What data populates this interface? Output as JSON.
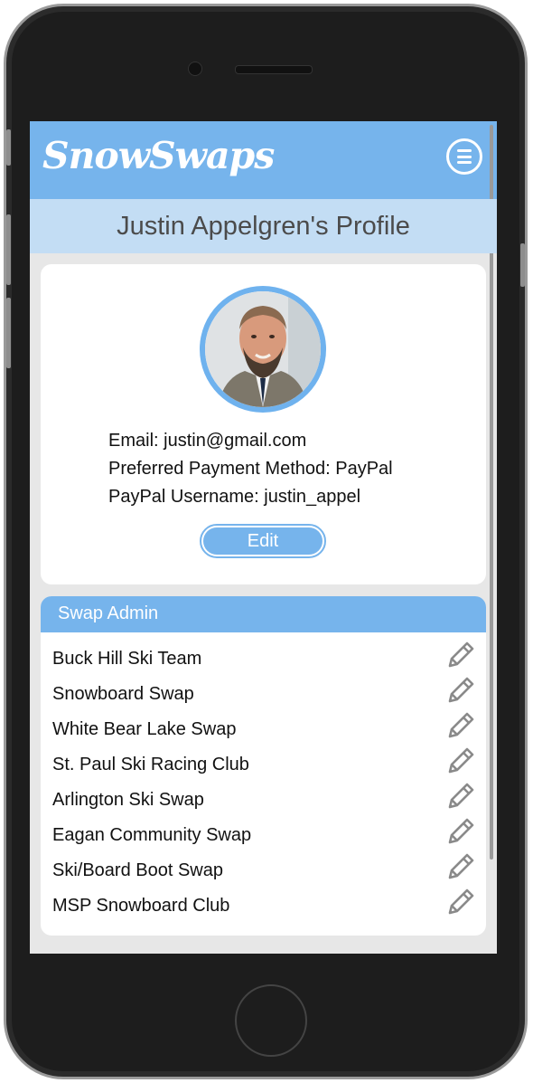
{
  "app": {
    "logo": "SnowSwaps"
  },
  "profile": {
    "title": "Justin Appelgren's Profile",
    "email_line": "Email: justin@gmail.com",
    "payment_line": "Preferred Payment Method: PayPal",
    "paypal_line": "PayPal Username: justin_appel",
    "edit_label": "Edit"
  },
  "swap_admin": {
    "title": "Swap Admin",
    "items": [
      {
        "label": "Buck Hill Ski Team"
      },
      {
        "label": "Snowboard Swap"
      },
      {
        "label": "White Bear Lake Swap"
      },
      {
        "label": "St. Paul Ski Racing Club"
      },
      {
        "label": "Arlington Ski Swap"
      },
      {
        "label": "Eagan Community Swap"
      },
      {
        "label": "Ski/Board Boot Swap"
      },
      {
        "label": "MSP Snowboard Club"
      }
    ]
  },
  "colors": {
    "accent": "#76b4ec",
    "profile_bar": "#c3ddf4",
    "background": "#e7e7e7"
  },
  "icons": {
    "menu": "hamburger-menu-icon",
    "row_action": "pencil-edit-icon"
  }
}
